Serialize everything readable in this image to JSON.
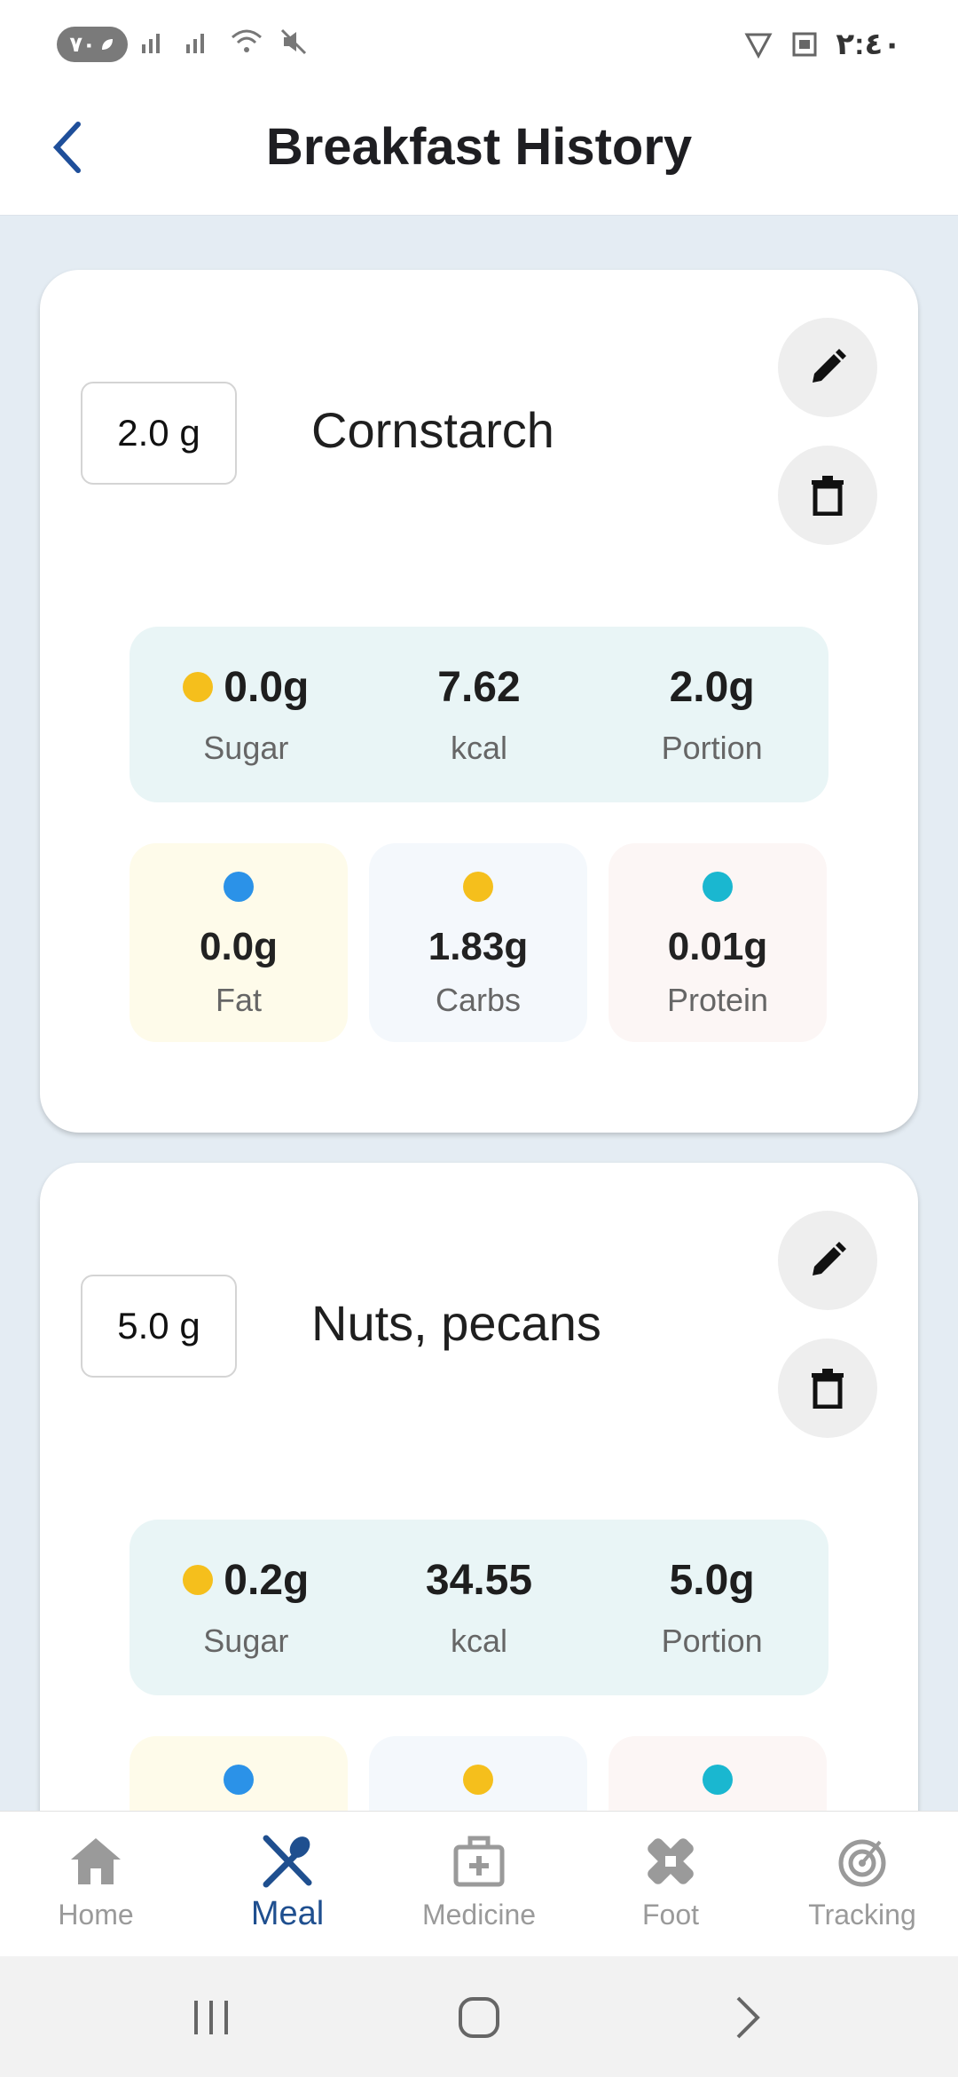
{
  "status_bar": {
    "pill_text": "٧٠",
    "time": "٢:٤٠"
  },
  "header": {
    "title": "Breakfast History",
    "back_icon": "chevron-left-icon"
  },
  "colors": {
    "sugar_dot": "#f5bf1c",
    "fat_dot": "#2b92e8",
    "carbs_dot": "#f5bf1c",
    "protein_dot": "#1ab7d0",
    "fat_tile": "#fefbea",
    "carbs_tile": "#f4f8fc",
    "protein_tile": "#fcf6f5",
    "summary_bg": "#e9f5f6",
    "active_nav": "#1f4f8f"
  },
  "meals": [
    {
      "quantity": "2.0 g",
      "name": "Cornstarch",
      "summary": [
        {
          "value": "0.0g",
          "label": "Sugar"
        },
        {
          "value": "7.62",
          "label": "kcal"
        },
        {
          "value": "2.0g",
          "label": "Portion"
        }
      ],
      "macros": [
        {
          "value": "0.0g",
          "label": "Fat"
        },
        {
          "value": "1.83g",
          "label": "Carbs"
        },
        {
          "value": "0.01g",
          "label": "Protein"
        }
      ]
    },
    {
      "quantity": "5.0 g",
      "name": "Nuts, pecans",
      "summary": [
        {
          "value": "0.2g",
          "label": "Sugar"
        },
        {
          "value": "34.55",
          "label": "kcal"
        },
        {
          "value": "5.0g",
          "label": "Portion"
        }
      ]
    }
  ],
  "bottom_nav": [
    {
      "label": "Home",
      "icon": "home-icon"
    },
    {
      "label": "Meal",
      "icon": "utensils-icon",
      "active": true
    },
    {
      "label": "Medicine",
      "icon": "medical-kit-icon"
    },
    {
      "label": "Foot",
      "icon": "bandage-icon"
    },
    {
      "label": "Tracking",
      "icon": "target-icon"
    }
  ],
  "system_nav": {
    "recents_icon": "recents-icon",
    "home_icon": "home-circle-icon",
    "back_icon": "back-arrow-icon"
  }
}
